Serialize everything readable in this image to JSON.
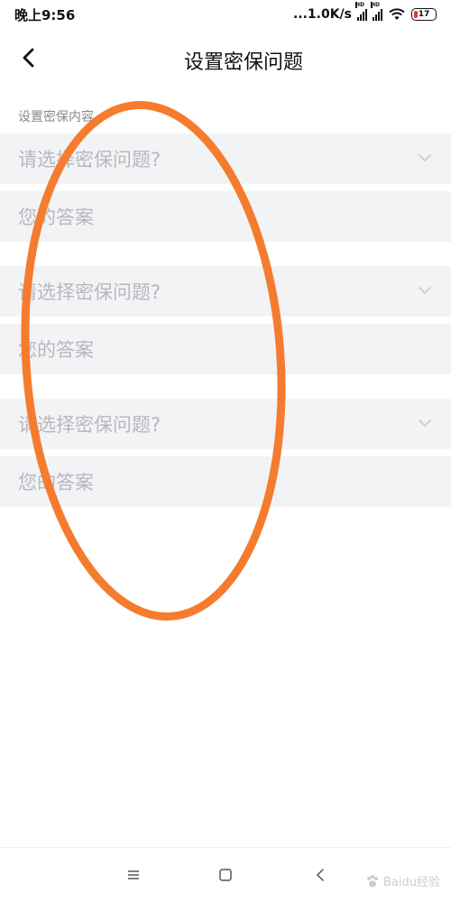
{
  "status_bar": {
    "time": "晚上9:56",
    "net_speed": "...1.0K/s",
    "sim1_tag": "HD",
    "sim2_tag": "HD",
    "battery": "17",
    "icons": [
      "signal-icon",
      "signal-icon",
      "wifi-icon",
      "battery-icon"
    ]
  },
  "header": {
    "title": "设置密保问题",
    "back_icon": "chevron-left-icon"
  },
  "section_label": "设置密保内容",
  "questions": [
    {
      "question_placeholder": "请选择密保问题?",
      "answer_placeholder": "您的答案"
    },
    {
      "question_placeholder": "请选择密保问题?",
      "answer_placeholder": "您的答案"
    },
    {
      "question_placeholder": "请选择密保问题?",
      "answer_placeholder": "您的答案"
    }
  ],
  "system_nav": {
    "icons": [
      "menu-icon",
      "home-icon",
      "back-icon"
    ]
  },
  "watermark": "Baidu经验",
  "colors": {
    "row_background": "#f2f3f5",
    "placeholder_text": "#b5b8bd",
    "annotation": "#f57c2e",
    "battery_low": "#e23b2e"
  }
}
